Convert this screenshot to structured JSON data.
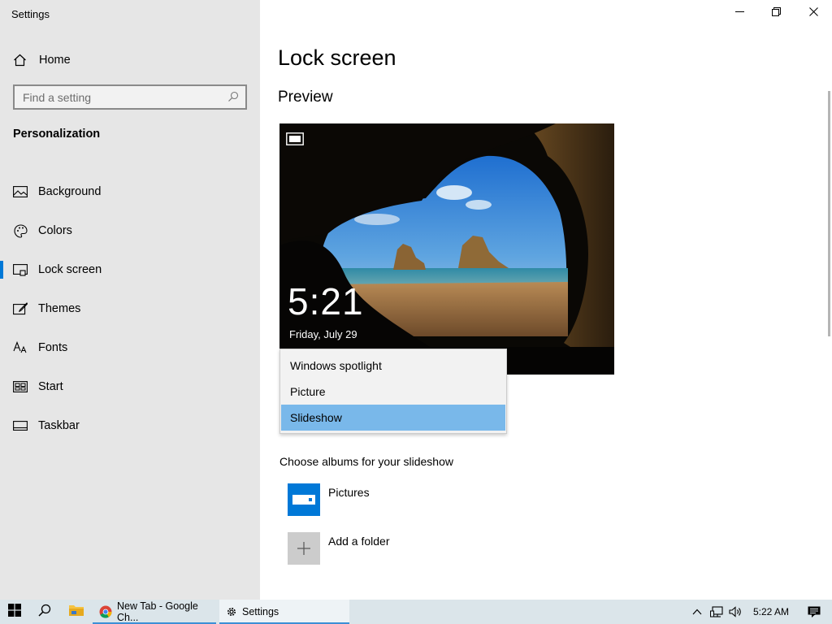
{
  "window": {
    "app_title": "Settings",
    "controls": [
      "minimize",
      "restore",
      "close"
    ]
  },
  "sidebar": {
    "home_label": "Home",
    "search_placeholder": "Find a setting",
    "section_title": "Personalization",
    "items": [
      {
        "label": "Background",
        "icon": "picture-icon"
      },
      {
        "label": "Colors",
        "icon": "palette-icon"
      },
      {
        "label": "Lock screen",
        "icon": "lock-screen-icon",
        "active": true
      },
      {
        "label": "Themes",
        "icon": "brush-icon"
      },
      {
        "label": "Fonts",
        "icon": "font-icon"
      },
      {
        "label": "Start",
        "icon": "start-icon"
      },
      {
        "label": "Taskbar",
        "icon": "taskbar-icon"
      }
    ]
  },
  "main": {
    "page_title": "Lock screen",
    "preview_title": "Preview",
    "preview": {
      "time": "5:21",
      "date": "Friday, July 29"
    },
    "background_dropdown": {
      "options": [
        "Windows spotlight",
        "Picture",
        "Slideshow"
      ],
      "selected": "Slideshow"
    },
    "albums_label": "Choose albums for your slideshow",
    "albums": [
      {
        "label": "Pictures"
      },
      {
        "label": "Add a folder"
      }
    ]
  },
  "taskbar": {
    "apps": [
      {
        "label": "New Tab - Google Ch...",
        "icon": "chrome-icon"
      },
      {
        "label": "Settings",
        "icon": "gear-icon"
      }
    ],
    "clock": "5:22 AM"
  },
  "colors": {
    "accent": "#0078d7",
    "sidebar_bg": "#e6e6e6",
    "dropdown_selected": "#79b8ea",
    "taskbar_bg": "#dbe5ea"
  }
}
